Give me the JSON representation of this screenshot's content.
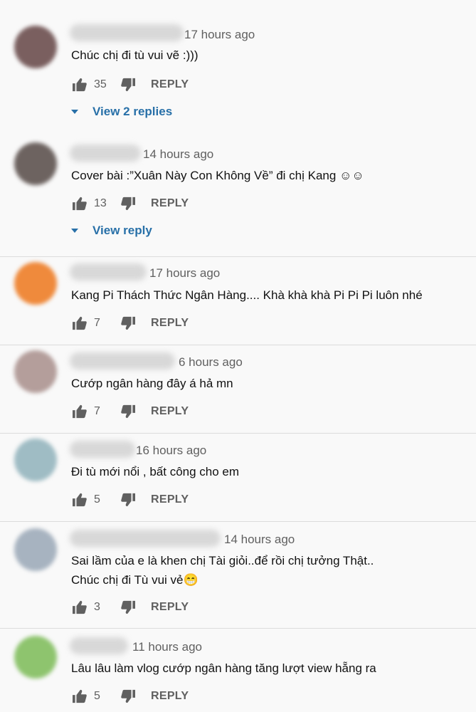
{
  "colors": {
    "background": "#f9f9f9",
    "link": "#2870a8",
    "secondary_text": "#606060"
  },
  "reply_label": "REPLY",
  "comments": [
    {
      "avatar_color": "#7a5f5f",
      "time": "17 hours ago",
      "text": "Chúc chị đi tù vui vẽ :)))",
      "likes": "35",
      "view_replies": "View 2 replies"
    },
    {
      "avatar_color": "#6d6360",
      "time": "14 hours ago",
      "text": "Cover bài :”Xuân Này Con Không Về” đi chị Kang ☺☺",
      "likes": "13",
      "view_replies": "View reply"
    },
    {
      "avatar_color": "#ef8a3c",
      "time": "17 hours ago",
      "text": "Kang Pi Thách Thức Ngân Hàng.... Khà khà khà Pi Pi Pi luôn nhé",
      "likes": "7"
    },
    {
      "avatar_color": "#b49e9b",
      "time": "6 hours ago",
      "text": "Cướp ngân hàng đây á hả mn",
      "likes": "7"
    },
    {
      "avatar_color": "#9fbcc4",
      "time": "16 hours ago",
      "text": "Đi tù mới nổi , bất công cho em",
      "likes": "5"
    },
    {
      "avatar_color": "#a7b3c0",
      "time": "14 hours ago",
      "text": "Sai lầm của e là khen chị Tài giỏi..để rồi chị tưởng Thật..\nChúc chị đi Tù vui vẻ😁",
      "likes": "3"
    },
    {
      "avatar_color": "#8ec46e",
      "time": "11 hours ago",
      "text": "Lâu lâu làm vlog cướp ngân hàng tăng lượt view hẵng ra",
      "likes": "5"
    }
  ]
}
